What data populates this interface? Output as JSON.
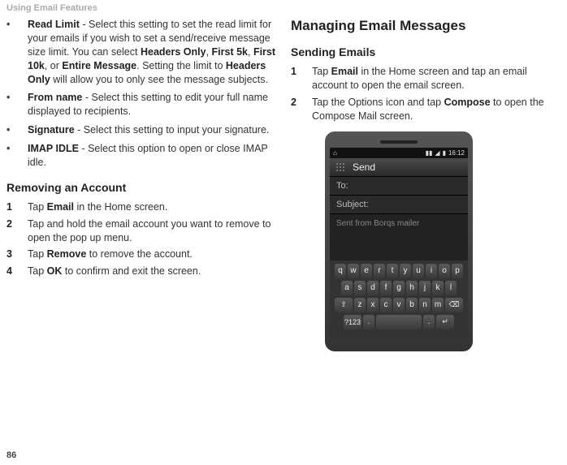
{
  "header": "Using Email Features",
  "page_number": "86",
  "left": {
    "bullets": [
      {
        "lead": "Read Limit",
        "tail": " - Select this setting to set the read limit for your emails if you wish to set a send/receive message size limit. You can select ",
        "bolds": [
          "Headers Only",
          "First 5k",
          "First 10k"
        ],
        "mid": ", or ",
        "bold2": "Entire Message",
        "tail2": ". Setting the limit to ",
        "bold3": "Headers Only",
        "tail3": " will allow you to only see the message subjects."
      },
      {
        "lead": "From name",
        "tail": " - Select this setting to edit your full name displayed to recipients."
      },
      {
        "lead": "Signature",
        "tail": " - Select this setting to input your signature."
      },
      {
        "lead": "IMAP IDLE",
        "tail": " - Select this option to open or close IMAP idle."
      }
    ],
    "section_title": "Removing an Account",
    "steps": [
      {
        "pre": "Tap ",
        "bold": "Email",
        "post": " in the Home screen."
      },
      {
        "text": "Tap and hold the email account you want to remove to open the pop up menu."
      },
      {
        "pre": "Tap ",
        "bold": "Remove",
        "post": " to remove the account."
      },
      {
        "pre": "Tap ",
        "bold": "OK",
        "post": " to confirm and exit the screen."
      }
    ]
  },
  "right": {
    "h1": "Managing Email Messages",
    "section_title": "Sending Emails",
    "steps": [
      {
        "pre": "Tap ",
        "bold": "Email",
        "post": " in the Home screen and tap an email account to open the email screen."
      },
      {
        "pre": "Tap the Options icon and tap ",
        "bold": "Compose",
        "post": " to open the Compose Mail screen."
      }
    ],
    "phone": {
      "time": "16:12",
      "send_label": "Send",
      "to_label": "To:",
      "subject_label": "Subject:",
      "body_placeholder": "Sent from Borqs mailer",
      "row1": [
        "q",
        "w",
        "e",
        "r",
        "t",
        "y",
        "u",
        "i",
        "o",
        "p"
      ],
      "row2": [
        "a",
        "s",
        "d",
        "f",
        "g",
        "h",
        "j",
        "k",
        "l"
      ],
      "row3": [
        "⇧",
        "z",
        "x",
        "c",
        "v",
        "b",
        "n",
        "m",
        "⌫"
      ],
      "row4": [
        "?123",
        ".",
        " ",
        ".",
        "↵"
      ]
    }
  }
}
